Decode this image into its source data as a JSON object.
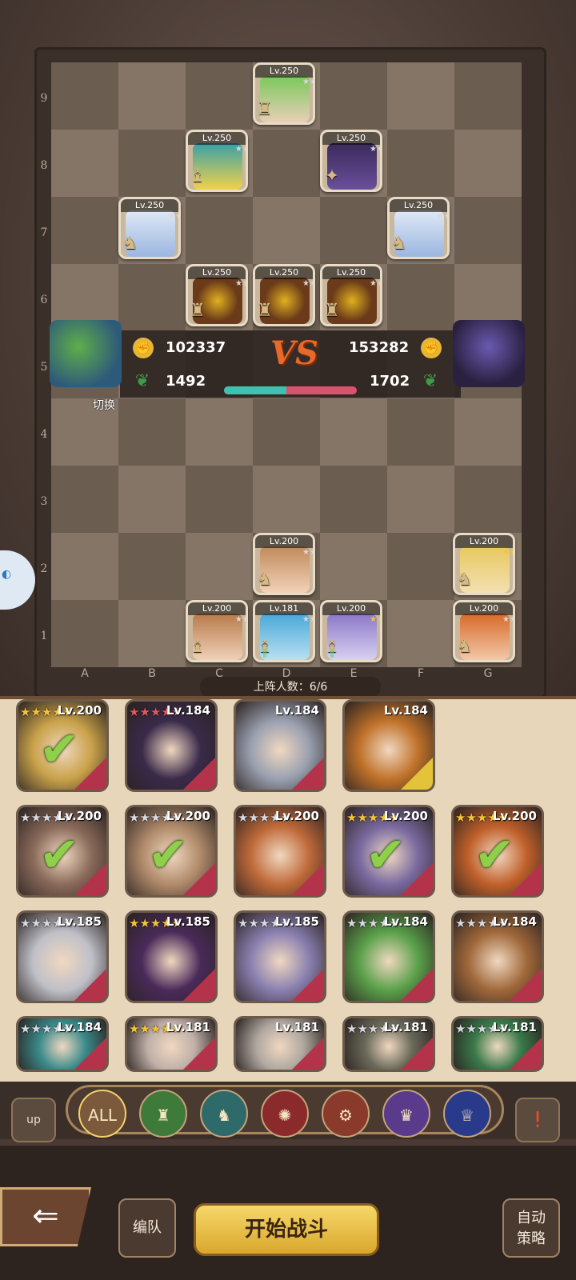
{
  "board": {
    "row_labels": [
      "9",
      "8",
      "7",
      "6",
      "5",
      "4",
      "3",
      "2",
      "1"
    ],
    "col_labels": [
      "A",
      "B",
      "C",
      "D",
      "E",
      "F",
      "G"
    ],
    "enemy_units": [
      {
        "level": "Lv.250"
      },
      {
        "level": "Lv.250"
      },
      {
        "level": "Lv.250"
      },
      {
        "level": "Lv.250"
      },
      {
        "level": "Lv.250"
      },
      {
        "level": "Lv.250"
      },
      {
        "level": "Lv.250"
      },
      {
        "level": "Lv.250"
      }
    ],
    "ally_units": [
      {
        "level": "Lv.200"
      },
      {
        "level": "Lv.200"
      },
      {
        "level": "Lv.200"
      },
      {
        "level": "Lv.181"
      },
      {
        "level": "Lv.200"
      },
      {
        "level": "Lv.200"
      }
    ]
  },
  "battle": {
    "left_power": "102337",
    "right_power": "153282",
    "left_score": "1492",
    "right_score": "1702",
    "vs_label": "VS",
    "switch_label": "切换",
    "hp_ratio": 0.47
  },
  "deploy_count": "上阵人数：6/6",
  "roster": [
    {
      "level": "Lv.200",
      "stars": "gold",
      "selected": true
    },
    {
      "level": "Lv.184",
      "stars": "red",
      "selected": false
    },
    {
      "level": "Lv.184",
      "stars": "none",
      "selected": false
    },
    {
      "level": "Lv.184",
      "stars": "none",
      "selected": false
    },
    {
      "level": "Lv.200",
      "stars": "silver",
      "selected": true
    },
    {
      "level": "Lv.200",
      "stars": "silver",
      "selected": true
    },
    {
      "level": "Lv.200",
      "stars": "silver",
      "selected": false
    },
    {
      "level": "Lv.200",
      "stars": "gold",
      "selected": true
    },
    {
      "level": "Lv.200",
      "stars": "gold",
      "selected": true
    },
    {
      "level": "Lv.185",
      "stars": "silver",
      "selected": false
    },
    {
      "level": "Lv.185",
      "stars": "gold",
      "selected": false
    },
    {
      "level": "Lv.185",
      "stars": "silver",
      "selected": false
    },
    {
      "level": "Lv.184",
      "stars": "silver",
      "selected": false
    },
    {
      "level": "Lv.184",
      "stars": "silver",
      "selected": false
    },
    {
      "level": "Lv.184",
      "stars": "silver",
      "selected": false
    },
    {
      "level": "Lv.181",
      "stars": "gold",
      "selected": false
    },
    {
      "level": "Lv.181",
      "stars": "none",
      "selected": false
    },
    {
      "level": "Lv.181",
      "stars": "silver",
      "selected": false
    },
    {
      "level": "Lv.181",
      "stars": "silver",
      "selected": false
    }
  ],
  "filters": {
    "up_label": "up",
    "all_label": "ALL",
    "info_label": "!",
    "icons": [
      "knight-icon",
      "horse-icon",
      "wheel-icon",
      "cart-icon",
      "lamp-icon",
      "queen-icon"
    ]
  },
  "actions": {
    "team_label": "编队",
    "start_label": "开始战斗",
    "auto_label": "自动策略"
  },
  "colors": {
    "ally_bar": "#3ec2b0",
    "enemy_bar": "#d9536e",
    "accent": "#e8b634"
  }
}
